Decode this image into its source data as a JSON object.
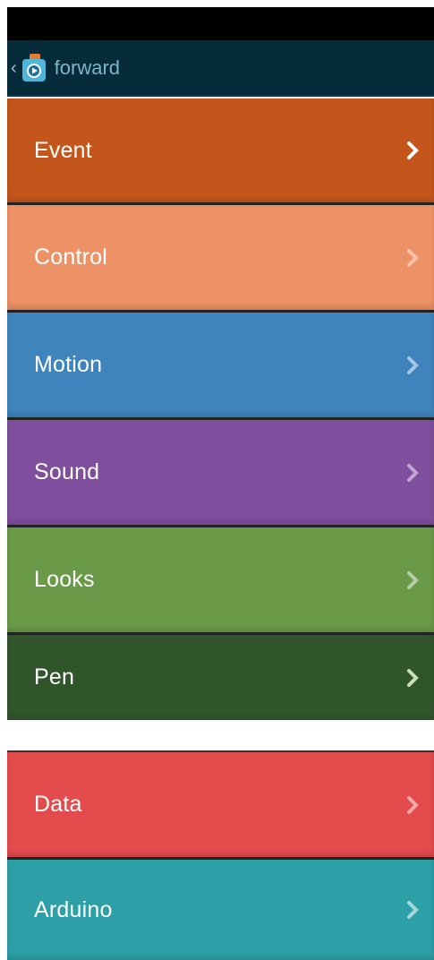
{
  "header": {
    "title": "forward",
    "back_icon": "chevron-left-icon",
    "app_icon": "scratch-play-bag-icon"
  },
  "categories": [
    {
      "label": "Event",
      "color": "#c4561b"
    },
    {
      "label": "Control",
      "color": "#ed9166"
    },
    {
      "label": "Motion",
      "color": "#3f84bc"
    },
    {
      "label": "Sound",
      "color": "#7f4f9d"
    },
    {
      "label": "Looks",
      "color": "#6a9947"
    },
    {
      "label": "Pen",
      "color": "#31552b"
    },
    {
      "label": "Data",
      "color": "#e34b4d"
    },
    {
      "label": "Arduino",
      "color": "#2d9fa7"
    }
  ],
  "chevron_icon": "chevron-right-icon"
}
